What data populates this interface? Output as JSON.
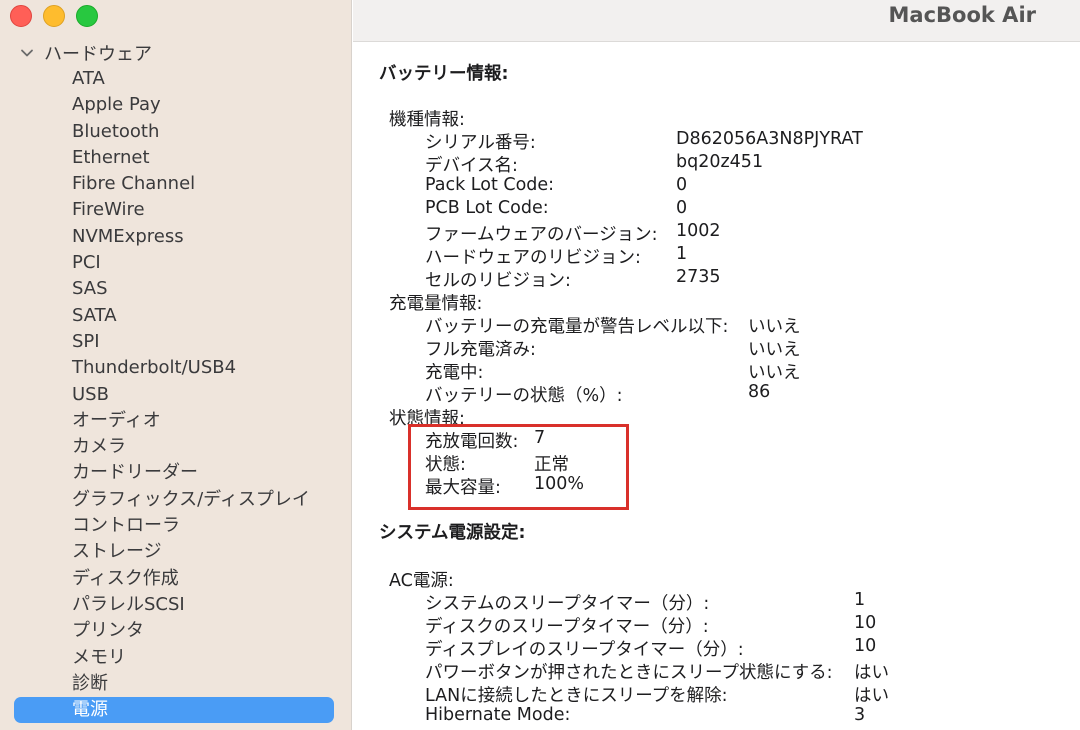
{
  "window": {
    "title": "MacBook Air"
  },
  "sidebar": {
    "group_label": "ハードウェア",
    "items": [
      {
        "label": "ATA"
      },
      {
        "label": "Apple Pay"
      },
      {
        "label": "Bluetooth"
      },
      {
        "label": "Ethernet"
      },
      {
        "label": "Fibre Channel"
      },
      {
        "label": "FireWire"
      },
      {
        "label": "NVMExpress"
      },
      {
        "label": "PCI"
      },
      {
        "label": "SAS"
      },
      {
        "label": "SATA"
      },
      {
        "label": "SPI"
      },
      {
        "label": "Thunderbolt/USB4"
      },
      {
        "label": "USB"
      },
      {
        "label": "オーディオ"
      },
      {
        "label": "カメラ"
      },
      {
        "label": "カードリーダー"
      },
      {
        "label": "グラフィックス/ディスプレイ"
      },
      {
        "label": "コントローラ"
      },
      {
        "label": "ストレージ"
      },
      {
        "label": "ディスク作成"
      },
      {
        "label": "パラレルSCSI"
      },
      {
        "label": "プリンタ"
      },
      {
        "label": "メモリ"
      },
      {
        "label": "診断"
      },
      {
        "label": "電源"
      }
    ],
    "selected": "電源"
  },
  "battery": {
    "section_title": "バッテリー情報:",
    "model_info": {
      "header": "機種情報:",
      "rows": [
        {
          "label": "シリアル番号:",
          "value": "D862056A3N8PJYRAT"
        },
        {
          "label": "デバイス名:",
          "value": "bq20z451"
        },
        {
          "label": "Pack Lot Code:",
          "value": "0"
        },
        {
          "label": "PCB Lot Code:",
          "value": "0"
        },
        {
          "label": "ファームウェアのバージョン:",
          "value": "1002"
        },
        {
          "label": "ハードウェアのリビジョン:",
          "value": "1"
        },
        {
          "label": "セルのリビジョン:",
          "value": "2735"
        }
      ]
    },
    "charge_info": {
      "header": "充電量情報:",
      "rows": [
        {
          "label": "バッテリーの充電量が警告レベル以下:",
          "value": "いいえ"
        },
        {
          "label": "フル充電済み:",
          "value": "いいえ"
        },
        {
          "label": "充電中:",
          "value": "いいえ"
        },
        {
          "label": "バッテリーの状態（%）:",
          "value": "86"
        }
      ]
    },
    "health_info": {
      "header": "状態情報:",
      "rows": [
        {
          "label": "充放電回数:",
          "value": "7"
        },
        {
          "label": "状態:",
          "value": "正常"
        },
        {
          "label": "最大容量:",
          "value": "100%"
        }
      ]
    }
  },
  "power_settings": {
    "section_title": "システム電源設定:",
    "ac_power": {
      "header": "AC電源:",
      "rows": [
        {
          "label": "システムのスリープタイマー（分）:",
          "value": "1"
        },
        {
          "label": "ディスクのスリープタイマー（分）:",
          "value": "10"
        },
        {
          "label": "ディスプレイのスリープタイマー（分）:",
          "value": "10"
        },
        {
          "label": "パワーボタンが押されたときにスリープ状態にする:",
          "value": "はい"
        },
        {
          "label": "LANに接続したときにスリープを解除:",
          "value": "はい"
        },
        {
          "label": "Hibernate Mode:",
          "value": "3"
        }
      ]
    }
  },
  "colors": {
    "sidebar_bg": "#efe5dc",
    "selection": "#4a9cf5",
    "highlight_box": "#d9302a"
  }
}
